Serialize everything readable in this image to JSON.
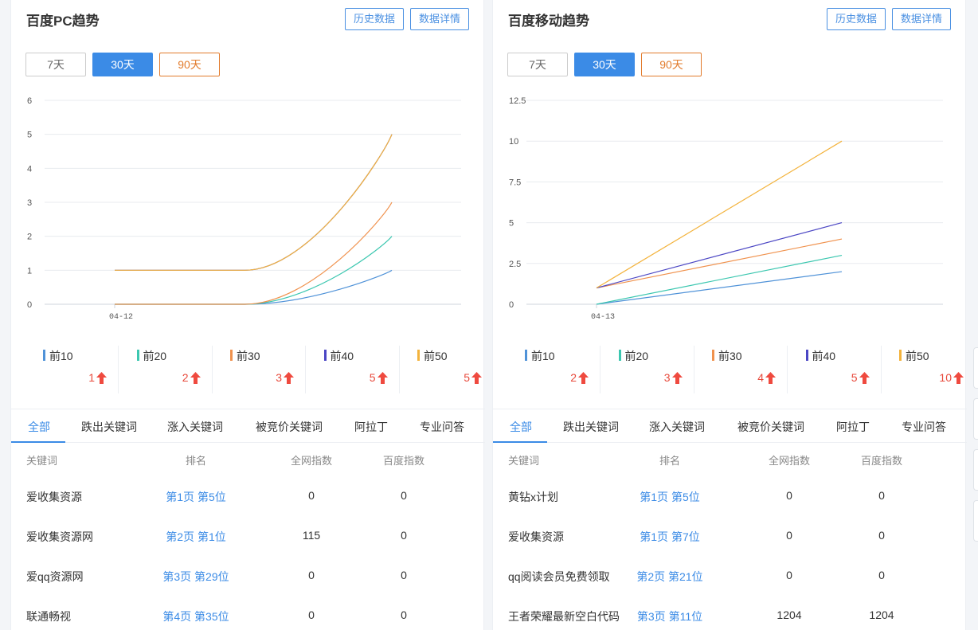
{
  "panels": [
    {
      "title": "百度PC趋势",
      "buttons": {
        "history": "历史数据",
        "detail": "数据详情"
      },
      "ranges": [
        "7天",
        "30天",
        "90天"
      ],
      "active_range": "30天",
      "legend": [
        {
          "label": "前10",
          "value": "1",
          "color": "#4f92d8"
        },
        {
          "label": "前20",
          "value": "2",
          "color": "#3cc7b0"
        },
        {
          "label": "前30",
          "value": "3",
          "color": "#f0924e"
        },
        {
          "label": "前40",
          "value": "5",
          "color": "#4b46c4"
        },
        {
          "label": "前50",
          "value": "5",
          "color": "#f3b33d"
        }
      ],
      "tabs": [
        "全部",
        "跌出关键词",
        "涨入关键词",
        "被竞价关键词",
        "阿拉丁",
        "专业问答"
      ],
      "table_headers": [
        "关键词",
        "排名",
        "全网指数",
        "百度指数"
      ],
      "rows": [
        {
          "keyword": "爱收集资源",
          "rank": "第1页 第5位",
          "all_index": "0",
          "baidu_index": "0"
        },
        {
          "keyword": "爱收集资源网",
          "rank": "第2页 第1位",
          "all_index": "115",
          "baidu_index": "0"
        },
        {
          "keyword": "爱qq资源网",
          "rank": "第3页 第29位",
          "all_index": "0",
          "baidu_index": "0"
        },
        {
          "keyword": "联通畅视",
          "rank": "第4页 第35位",
          "all_index": "0",
          "baidu_index": "0"
        }
      ]
    },
    {
      "title": "百度移动趋势",
      "buttons": {
        "history": "历史数据",
        "detail": "数据详情"
      },
      "ranges": [
        "7天",
        "30天",
        "90天"
      ],
      "active_range": "30天",
      "legend": [
        {
          "label": "前10",
          "value": "2",
          "color": "#4f92d8"
        },
        {
          "label": "前20",
          "value": "3",
          "color": "#3cc7b0"
        },
        {
          "label": "前30",
          "value": "4",
          "color": "#f0924e"
        },
        {
          "label": "前40",
          "value": "5",
          "color": "#4b46c4"
        },
        {
          "label": "前50",
          "value": "10",
          "color": "#f3b33d"
        }
      ],
      "tabs": [
        "全部",
        "跌出关键词",
        "涨入关键词",
        "被竞价关键词",
        "阿拉丁",
        "专业问答"
      ],
      "table_headers": [
        "关键词",
        "排名",
        "全网指数",
        "百度指数"
      ],
      "rows": [
        {
          "keyword": "黄钻x计划",
          "rank": "第1页 第5位",
          "all_index": "0",
          "baidu_index": "0"
        },
        {
          "keyword": "爱收集资源",
          "rank": "第1页 第7位",
          "all_index": "0",
          "baidu_index": "0"
        },
        {
          "keyword": "qq阅读会员免费领取",
          "rank": "第2页 第21位",
          "all_index": "0",
          "baidu_index": "0"
        },
        {
          "keyword": "王者荣耀最新空白代码",
          "rank": "第3页 第11位",
          "all_index": "1204",
          "baidu_index": "1204"
        }
      ]
    }
  ],
  "chart_data": [
    {
      "type": "line",
      "x": [
        "04-12",
        "",
        "",
        ""
      ],
      "x_tick_labels": [
        "04-12"
      ],
      "yticks": [
        "0",
        "1",
        "2",
        "3",
        "4",
        "5",
        "6"
      ],
      "ylim": [
        0,
        6
      ],
      "grid": true,
      "series": [
        {
          "name": "前10",
          "values": [
            0,
            0,
            1
          ],
          "color": "#4f92d8"
        },
        {
          "name": "前20",
          "values": [
            0,
            0,
            2
          ],
          "color": "#3cc7b0"
        },
        {
          "name": "前30",
          "values": [
            0,
            0,
            3
          ],
          "color": "#f0924e"
        },
        {
          "name": "前40",
          "values": [
            1,
            1,
            5
          ],
          "color": "#4b46c4"
        },
        {
          "name": "前50",
          "values": [
            1,
            1,
            5
          ],
          "color": "#f3b33d"
        }
      ]
    },
    {
      "type": "line",
      "x": [
        "04-13",
        ""
      ],
      "x_tick_labels": [
        "04-13"
      ],
      "yticks": [
        "0",
        "2.5",
        "5",
        "7.5",
        "10",
        "12.5"
      ],
      "ylim": [
        0,
        12.5
      ],
      "grid": true,
      "series": [
        {
          "name": "前10",
          "values": [
            0,
            2
          ],
          "color": "#4f92d8"
        },
        {
          "name": "前20",
          "values": [
            0,
            3
          ],
          "color": "#3cc7b0"
        },
        {
          "name": "前30",
          "values": [
            1,
            4
          ],
          "color": "#f0924e"
        },
        {
          "name": "前40",
          "values": [
            1,
            5
          ],
          "color": "#4b46c4"
        },
        {
          "name": "前50",
          "values": [
            1,
            10
          ],
          "color": "#f3b33d"
        }
      ]
    }
  ]
}
